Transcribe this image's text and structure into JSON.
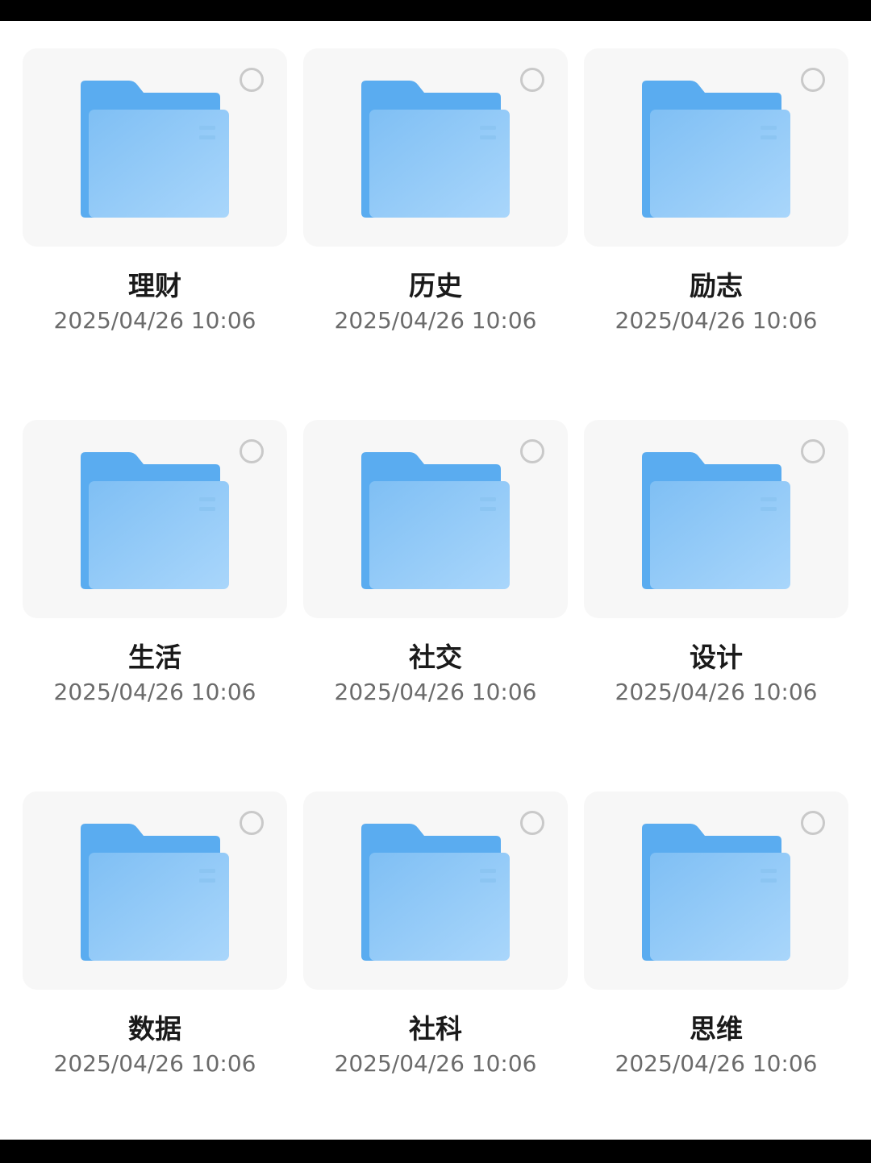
{
  "colors": {
    "folder_back": "#5aacf0",
    "folder_front_light": "#a9d6fb",
    "folder_front_dark": "#7fbff4",
    "thumb_bg": "#f7f7f7",
    "name_text": "#1a1a1a",
    "date_text": "#6b6b6b",
    "circle": "#c9c9c9"
  },
  "icons": {
    "folder": "folder-icon",
    "select": "radio-circle-icon"
  },
  "folders": [
    {
      "name": "理财",
      "date": "2025/04/26 10:06"
    },
    {
      "name": "历史",
      "date": "2025/04/26 10:06"
    },
    {
      "name": "励志",
      "date": "2025/04/26 10:06"
    },
    {
      "name": "生活",
      "date": "2025/04/26 10:06"
    },
    {
      "name": "社交",
      "date": "2025/04/26 10:06"
    },
    {
      "name": "设计",
      "date": "2025/04/26 10:06"
    },
    {
      "name": "数据",
      "date": "2025/04/26 10:06"
    },
    {
      "name": "社科",
      "date": "2025/04/26 10:06"
    },
    {
      "name": "思维",
      "date": "2025/04/26 10:06"
    }
  ]
}
